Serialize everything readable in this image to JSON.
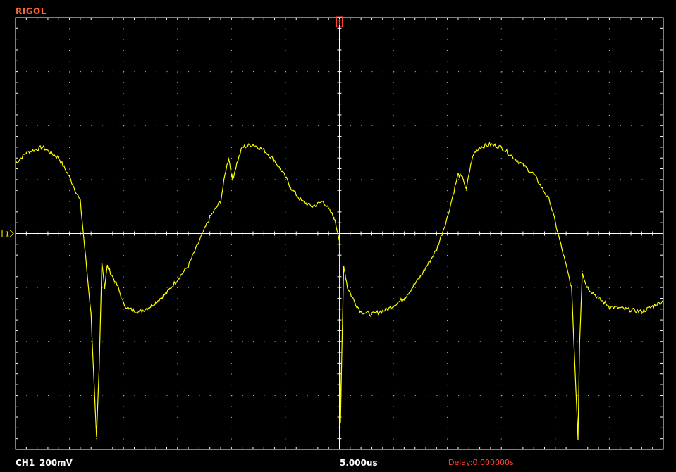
{
  "brand": "RIGOL",
  "channel": {
    "label": "CH1",
    "scale": "200mV",
    "marker": "1",
    "color": "#ffff00"
  },
  "timebase": "5.000us",
  "delay": "Delay:0.000000s",
  "colors": {
    "background": "#000000",
    "grid": "#ffffff",
    "trace": "#ffff00",
    "brand": "#ff6633",
    "trigger": "#ff4433"
  },
  "chart_data": {
    "type": "line",
    "title": "",
    "xlabel": "",
    "ylabel": "",
    "x_divisions": 12,
    "y_divisions": 8,
    "xlim": [
      -6,
      6
    ],
    "ylim": [
      -4,
      4
    ],
    "grid": true,
    "series": [
      {
        "x": [
          -6.0,
          -5.8,
          -5.5,
          -5.2,
          -5.0,
          -4.8,
          -4.6,
          -4.5,
          -4.45,
          -4.4,
          -4.35,
          -4.3,
          -4.2,
          -4.1,
          -4.0,
          -3.9,
          -3.7,
          -3.5,
          -3.2,
          -2.8,
          -2.4,
          -2.2,
          -2.1,
          -2.05,
          -2.0,
          -1.98,
          -1.9,
          -1.8,
          -1.6,
          -1.4,
          -1.2,
          -1.0,
          -0.9,
          -0.7,
          -0.5,
          -0.3,
          -0.1,
          0.0,
          0.02,
          0.05,
          0.08,
          0.1,
          0.15,
          0.2,
          0.3,
          0.4,
          0.6,
          0.9,
          1.2,
          1.5,
          1.8,
          2.0,
          2.2,
          2.3,
          2.35,
          2.4,
          2.45,
          2.5,
          2.6,
          2.8,
          3.0,
          3.3,
          3.6,
          3.9,
          4.1,
          4.3,
          4.42,
          4.45,
          4.5,
          4.55,
          4.6,
          4.7,
          4.8,
          5.0,
          5.3,
          5.6,
          5.9,
          6.0
        ],
        "y": [
          1.3,
          1.5,
          1.6,
          1.4,
          1.05,
          0.6,
          -1.5,
          -3.8,
          -2.5,
          -0.5,
          -1.0,
          -0.6,
          -0.8,
          -1.0,
          -1.3,
          -1.4,
          -1.45,
          -1.35,
          -1.1,
          -0.6,
          0.3,
          0.6,
          1.2,
          1.4,
          1.1,
          1.0,
          1.3,
          1.6,
          1.65,
          1.55,
          1.35,
          1.05,
          0.85,
          0.6,
          0.5,
          0.6,
          0.3,
          -0.1,
          -3.5,
          -2.0,
          -0.6,
          -0.7,
          -1.0,
          -1.1,
          -1.3,
          -1.45,
          -1.5,
          -1.4,
          -1.2,
          -0.8,
          -0.3,
          0.3,
          1.1,
          1.0,
          0.8,
          1.1,
          1.35,
          1.5,
          1.6,
          1.65,
          1.6,
          1.35,
          1.1,
          0.6,
          -0.2,
          -1.0,
          -3.8,
          -2.0,
          -0.7,
          -0.9,
          -1.0,
          -1.1,
          -1.2,
          -1.35,
          -1.4,
          -1.45,
          -1.3,
          -1.25
        ]
      }
    ]
  }
}
